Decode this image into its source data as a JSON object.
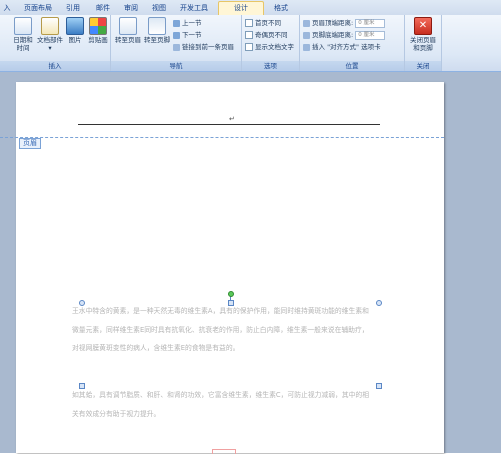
{
  "tabs": [
    {
      "label": "入"
    },
    {
      "label": "页面布局"
    },
    {
      "label": "引用"
    },
    {
      "label": "邮件"
    },
    {
      "label": "审阅"
    },
    {
      "label": "视图"
    },
    {
      "label": "开发工具"
    },
    {
      "label": "设计"
    },
    {
      "label": "格式"
    }
  ],
  "ribbon": {
    "insert_group": {
      "label": "插入",
      "date_time": "日期和\n时间",
      "doc_parts": "文档部件",
      "picture": "图片",
      "clipart": "剪贴画"
    },
    "nav_group": {
      "label": "导航",
      "goto_header": "转至页眉",
      "goto_footer": "转至页脚",
      "prev_section": "上一节",
      "next_section": "下一节",
      "link_prev": "链接到前一条页眉"
    },
    "options_group": {
      "label": "选项",
      "diff_first": "首页不同",
      "diff_odd_even": "奇偶页不同",
      "show_doc_text": "显示文档文字"
    },
    "position_group": {
      "label": "位置",
      "header_top_label": "页眉顶端距离:",
      "header_top_value": "0 厘米",
      "footer_bottom_label": "页脚底端距离:",
      "footer_bottom_value": "0 厘米",
      "insert_align_tab": "插入 \"对齐方式\" 选项卡"
    },
    "close_group": {
      "label": "关闭",
      "close_btn": "关闭页眉\n和页脚"
    }
  },
  "document": {
    "header_tag": "页眉",
    "para_mark": "↵",
    "paragraph1": "王水中特含的黄素，是一种天然无毒的维生素A，具有的保护作用，能同时维持黄斑功能的维生素和微量元素，同样维生素E同时具有抗氧化、抗衰老的作用，防止白内障，维生素一般来说在辅助疗，对视网膜黄斑变性的病人，含维生素E的食物是有益的。",
    "paragraph2": "如其蛤，具有调节脂质、和肝、和肾的功效，它富含维生素，维生素C，可防止视力减弱，其中的相关有效成分有助于视力提升。"
  },
  "colors": {
    "tab_bg": "#dfe9f5",
    "ribbon_bg": "#dde8f6",
    "doc_bg": "#a9b9cf",
    "accent": "#15428b"
  }
}
